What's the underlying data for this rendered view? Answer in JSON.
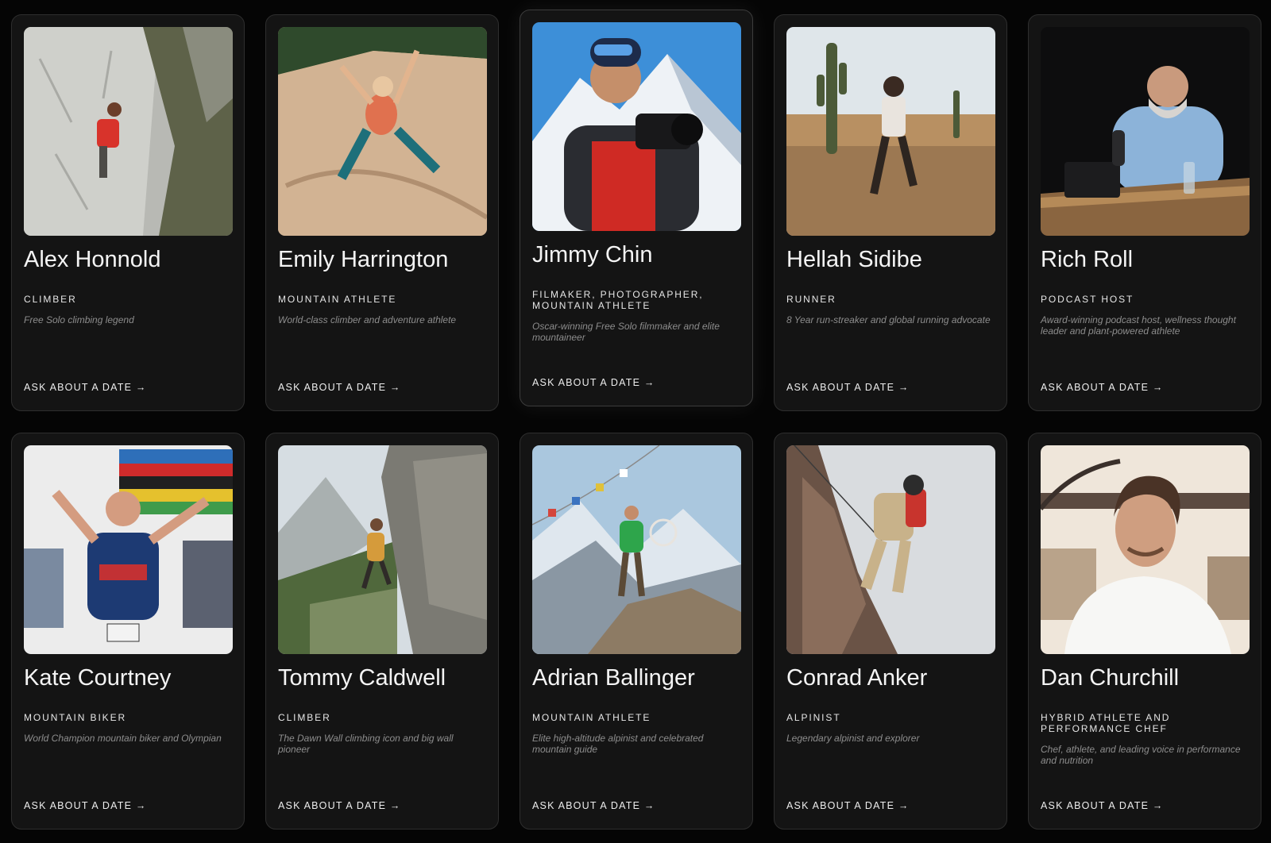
{
  "cta_label": "ASK ABOUT A DATE →",
  "athletes": [
    {
      "name": "Alex Honnold",
      "role": "CLIMBER",
      "description": "Free Solo climbing legend"
    },
    {
      "name": "Emily Harrington",
      "role": "MOUNTAIN ATHLETE",
      "description": "World-class climber and adventure athlete"
    },
    {
      "name": "Jimmy Chin",
      "role": "FILMAKER, PHOTOGRAPHER, MOUNTAIN ATHLETE",
      "description": "Oscar-winning Free Solo filmmaker and elite mountaineer"
    },
    {
      "name": "Hellah Sidibe",
      "role": "RUNNER",
      "description": "8 Year run-streaker and global running advocate"
    },
    {
      "name": "Rich Roll",
      "role": "PODCAST HOST",
      "description": "Award-winning podcast host, wellness thought leader and plant-powered athlete"
    },
    {
      "name": "Kate Courtney",
      "role": "MOUNTAIN BIKER",
      "description": "World Champion mountain biker and Olympian"
    },
    {
      "name": "Tommy Caldwell",
      "role": "CLIMBER",
      "description": "The Dawn Wall climbing icon and big wall pioneer"
    },
    {
      "name": "Adrian Ballinger",
      "role": "MOUNTAIN ATHLETE",
      "description": "Elite high-altitude alpinist and celebrated mountain guide"
    },
    {
      "name": "Conrad Anker",
      "role": "ALPINIST",
      "description": "Legendary alpinist and explorer"
    },
    {
      "name": "Dan Churchill",
      "role": "HYBRID ATHLETE AND PERFORMANCE CHEF",
      "description": "Chef, athlete, and leading voice in performance and nutrition"
    }
  ]
}
